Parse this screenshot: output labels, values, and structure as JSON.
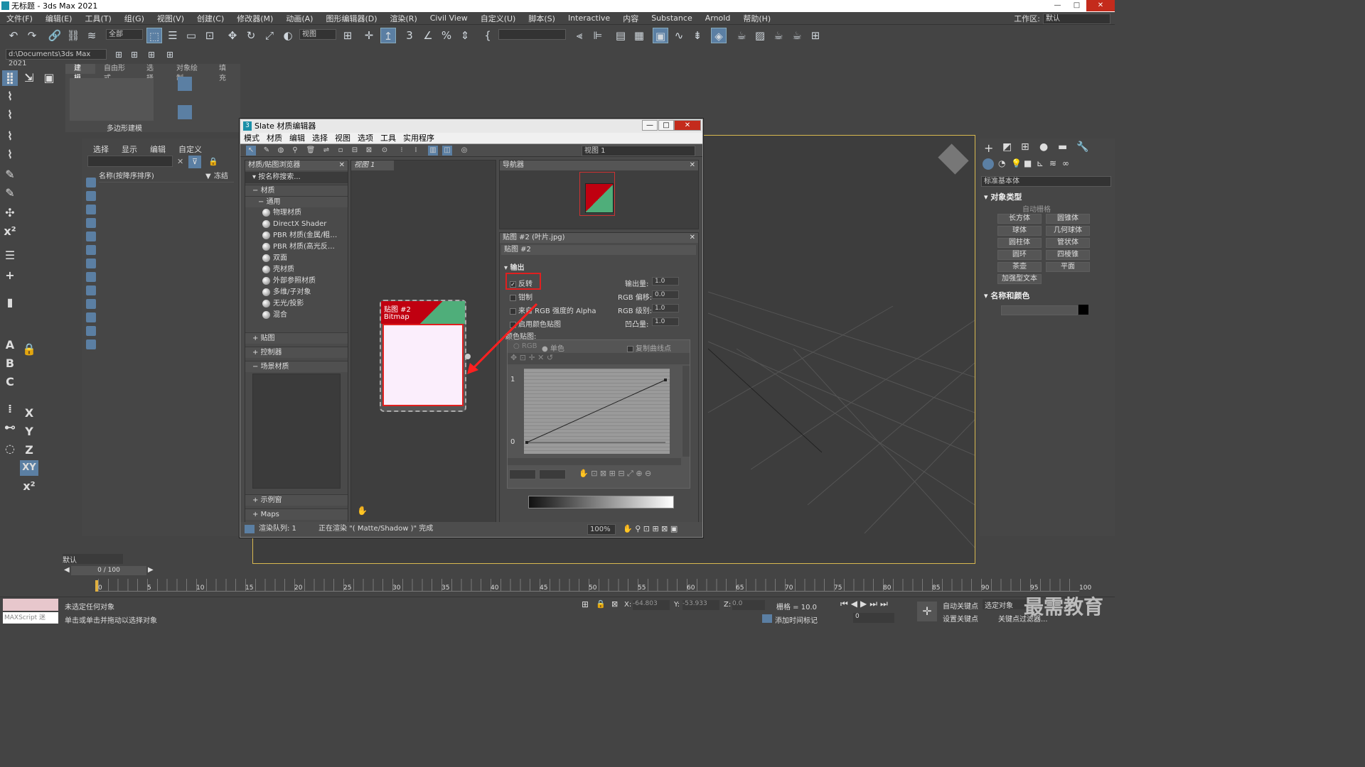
{
  "title": "无标题 - 3ds Max 2021",
  "menu": [
    "文件(F)",
    "编辑(E)",
    "工具(T)",
    "组(G)",
    "视图(V)",
    "创建(C)",
    "修改器(M)",
    "动画(A)",
    "图形编辑器(D)",
    "渲染(R)",
    "Civil View",
    "自定义(U)",
    "脚本(S)",
    "Interactive",
    "内容",
    "Substance",
    "Arnold",
    "帮助(H)"
  ],
  "workspace": {
    "label": "工作区:",
    "value": "默认"
  },
  "toolbar": {
    "filter": "全部",
    "refcoord": "视图"
  },
  "path": "d:\\Documents\\3ds Max 2021",
  "ribbon": {
    "tabs": [
      "建模",
      "自由形式",
      "选择",
      "对象绘制",
      "填充"
    ],
    "group": "多边形建模"
  },
  "scene": {
    "menu": [
      "选择",
      "显示",
      "编辑",
      "自定义"
    ],
    "col_name": "名称(按降序排序)",
    "col_frozen": "冻结"
  },
  "layer": "默认",
  "slate": {
    "title": "Slate 材质编辑器",
    "menu": [
      "模式",
      "材质",
      "编辑",
      "选择",
      "视图",
      "选项",
      "工具",
      "实用程序"
    ],
    "view_combo": "视图 1",
    "browser_title": "材质/贴图浏览器",
    "search": "按名称搜索...",
    "group_materials": "材质",
    "group_general": "通用",
    "materials": [
      "物理材质",
      "DirectX Shader",
      "PBR 材质(金属/粗…",
      "PBR 材质(高光反…",
      "双面",
      "壳材质",
      "外部参照材质",
      "多维/子对象",
      "无光/投影",
      "混合"
    ],
    "groups": [
      "贴图",
      "控制器",
      "场景材质"
    ],
    "bottom_groups": [
      "示例窗",
      "Maps"
    ],
    "view_tab": "视图 1",
    "node_title": "贴图 #2",
    "node_type": "Bitmap",
    "nav_title": "导航器",
    "param_title": "贴图 #2 (叶片.jpg)",
    "param_name": "贴图 #2",
    "output_title": "输出",
    "invert": "反转",
    "clamp": "钳制",
    "alpha_from_rgb": "来自 RGB 强度的 Alpha",
    "enable_color_map": "启用颜色贴图",
    "output_amount_label": "输出量:",
    "output_amount": "1.0",
    "rgb_offset_label": "RGB 偏移:",
    "rgb_offset": "0.0",
    "rgb_level_label": "RGB 级别:",
    "rgb_level": "1.0",
    "bump_label": "凹凸量:",
    "bump": "1.0",
    "color_map": "颜色贴图:",
    "rgb": "RGB",
    "mono": "单色",
    "copy_points": "复制曲线点",
    "y1": "1",
    "y0": "0",
    "status_queue": "渲染队列: 1",
    "status_msg": "正在渲染 \"( Matte/Shadow )\" 完成",
    "zoom": "100%"
  },
  "right": {
    "category": "标准基本体",
    "object_type": "对象类型",
    "auto_grid": "自动栅格",
    "buttons": [
      "长方体",
      "圆锥体",
      "球体",
      "几何球体",
      "圆柱体",
      "管状体",
      "圆环",
      "四棱锥",
      "茶壶",
      "平面",
      "加强型文本"
    ],
    "name_color": "名称和颜色"
  },
  "timeline": {
    "frame": "0 / 100",
    "ticks": [
      "0",
      "5",
      "10",
      "15",
      "20",
      "25",
      "30",
      "35",
      "40",
      "45",
      "50",
      "55",
      "60",
      "65",
      "70",
      "75",
      "80",
      "85",
      "90",
      "95",
      "100"
    ]
  },
  "status": {
    "line1": "未选定任何对象",
    "line2": "单击或单击并拖动以选择对象",
    "maxscript": "MAXScript 迷",
    "x_label": "X:",
    "x": "-64.803",
    "y_label": "Y:",
    "y": "-53.933",
    "z_label": "Z:",
    "z": "0.0",
    "grid": "栅格 = 10.0",
    "add_tag": "添加时间标记",
    "auto_key": "自动关键点",
    "selected": "选定对象",
    "set_key": "设置关键点",
    "key_filter": "关键点过滤器...",
    "frame_input": "0"
  },
  "watermark": "最需教育",
  "colors": {
    "accent": "#5b7fa3",
    "highlight": "#e02020",
    "node_red": "#c00010",
    "node_green": "#4fae7a"
  }
}
